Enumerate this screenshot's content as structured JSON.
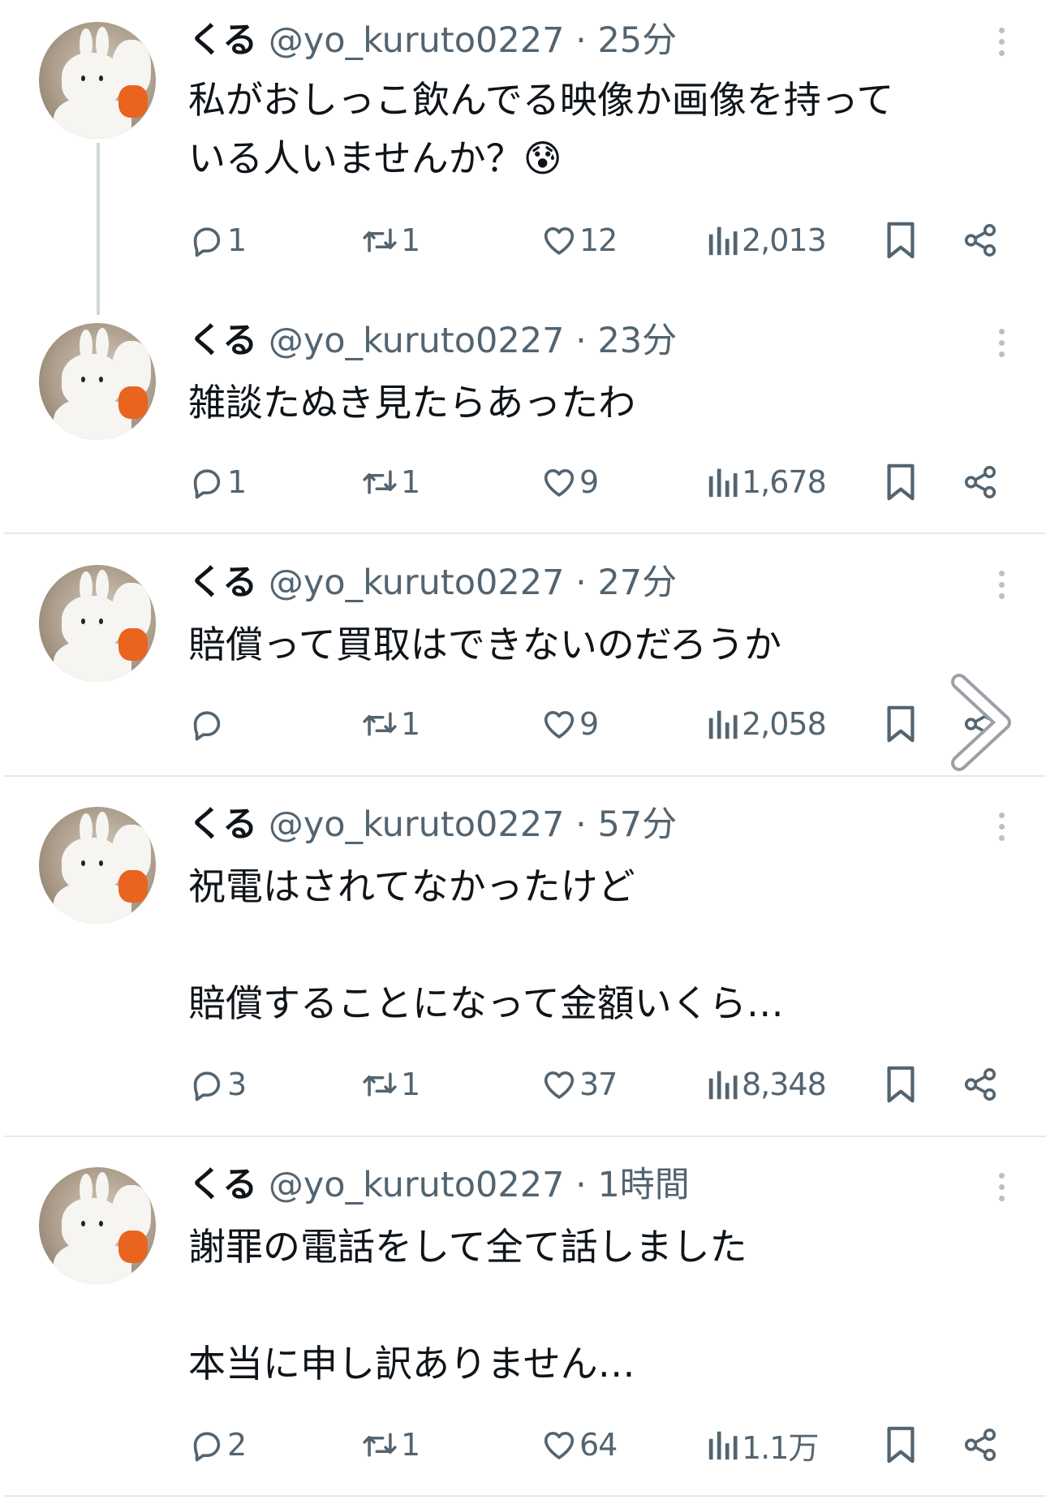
{
  "tweets": [
    {
      "name": "くる",
      "handle": "@yo_kuruto0227",
      "time": "· 25分",
      "text": "私がおしっこ飲んでる映像か画像を持って\nいる人いませんか？😰",
      "replies": "1",
      "retweets": "1",
      "likes": "12",
      "views": "2,013"
    },
    {
      "name": "くる",
      "handle": "@yo_kuruto0227",
      "time": "· 23分",
      "text": "雑談たぬき見たらあったわ",
      "replies": "1",
      "retweets": "1",
      "likes": "9",
      "views": "1,678"
    },
    {
      "name": "くる",
      "handle": "@yo_kuruto0227",
      "time": "· 27分",
      "text": "賠償って買取はできないのだろうか",
      "replies": "",
      "retweets": "1",
      "likes": "9",
      "views": "2,058"
    },
    {
      "name": "くる",
      "handle": "@yo_kuruto0227",
      "time": "· 57分",
      "text": "祝電はされてなかったけど\n\n賠償することになって金額いくら…",
      "replies": "3",
      "retweets": "1",
      "likes": "37",
      "views": "8,348"
    },
    {
      "name": "くる",
      "handle": "@yo_kuruto0227",
      "time": "· 1時間",
      "text": "謝罪の電話をして全て話しました\n\n本当に申し訳ありません…",
      "replies": "2",
      "retweets": "1",
      "likes": "64",
      "views": "1.1万"
    }
  ],
  "icons": {
    "reply": "speech-bubble",
    "retweet": "repost-arrows",
    "like": "heart",
    "views": "bar-chart",
    "bookmark": "bookmark",
    "share": "share-nodes",
    "more": "vertical-dots",
    "next": "chevron-right"
  },
  "colors": {
    "text": "#0f1419",
    "secondary": "#536471",
    "divider": "#e6e9ec",
    "thread_line": "#cfd9de"
  }
}
